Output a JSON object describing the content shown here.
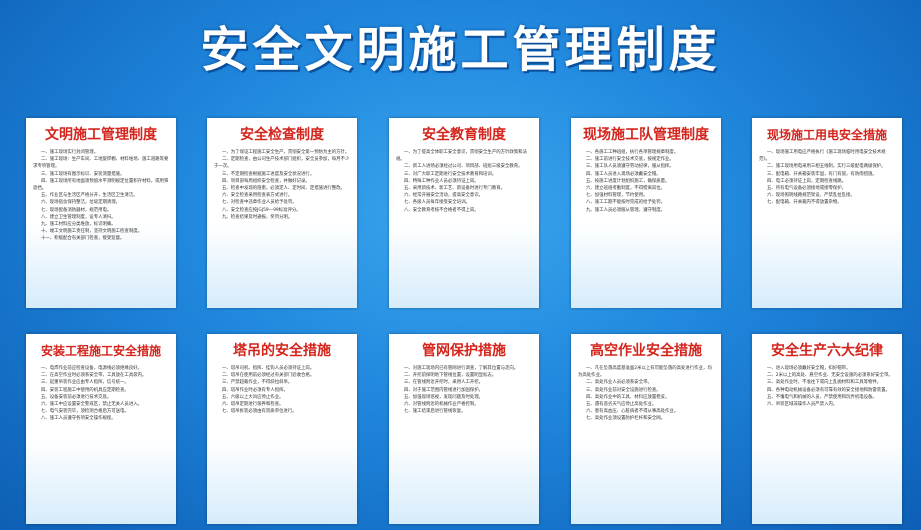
{
  "title": "安全文明施工管理制度",
  "panels": [
    {
      "title": "文明施工管理制度",
      "lines": [
        "一、施工现场实行封闭管理。",
        "二、施工现场：生产车间、工地旋焊棚、材料堆场、施工道路等要求专项管理。",
        "三、施工现场有图示标识、安装测量措施。",
        "四、施工现场所有地面须预留水平测明规定位置积存材料，或用筛遮挡。",
        "五、作业区与生活区严格分开，生活区卫生清洁。",
        "六、现场宿舍保持整洁，垃圾定期清理。",
        "七、现场配备消防器材，规范用电。",
        "八、建立卫生管理制度，设专人清扫。",
        "九、施工材料应分类堆放，标识明确。",
        "十、竣工文明施工责任制，坚持文明施工检查制度。",
        "十一、积极配合有关部门检查，接受监督。"
      ]
    },
    {
      "title": "安全检查制度",
      "lines": [
        "一、为了保证工程施工安全生产，贯彻安全第一预防为主的方针。",
        "二、定期检查，由公司生产技术部门组织，安全员参加，每月不少于一次。",
        "三、不定期检查根据施工进度及安全状况进行。",
        "四、项目部每周组织安全检查，并做好记录。",
        "五、检查中发现的隐患，必须定人、定时间、定措施进行整改。",
        "六、安全检查采用检查表方式进行。",
        "七、对检查中违章作业人员给予处罚。",
        "八、安全检查应按JGJ59—99标准评分。",
        "九、检查结果及时通报，奖罚分明。"
      ]
    },
    {
      "title": "安全教育制度",
      "lines": [
        "一、为了提高全体职工安全意识，贯彻安全生产的方针政策和法规。",
        "二、新工人进场必须经过公司、项目部、班组三级安全教育。",
        "三、对广大职工定期进行安全技术教育和培训。",
        "四、特殊工种作业人员必须持证上岗。",
        "五、采用新技术、新工艺、新设备时进行专门教育。",
        "六、经常开展安全活动，提高安全意识。",
        "七、各级人员每年接受安全培训。",
        "八、安全教育考核不合格者不得上岗。"
      ]
    },
    {
      "title": "现场施工队管理制度",
      "lines": [
        "一、各施工工种班组，执行各项管理规章制度。",
        "二、施工前进行安全技术交底，按规定作业。",
        "三、施工队人员须遵守劳动纪律，服从指挥。",
        "四、施工人员进入现场必须戴安全帽。",
        "五、按施工进度计划组织施工，确保质量。",
        "六、建立班组考勤制度，不得擅离岗位。",
        "七、加强材料管理，节约使用。",
        "八、施工工期不能按时完成的给予处罚。",
        "九、施工人员必须服从管理，遵守制度。"
      ]
    },
    {
      "title": "现场施工用电安全措施",
      "small": true,
      "lines": [
        "一、现场施工用电应严格执行《施工现场临时用电安全技术规范》。",
        "二、施工现场用电采用三相五线制，实行三级配电两级保护。",
        "三、配电箱、开关箱安装牢固，有门有锁，有防雨措施。",
        "四、电工必须持证上岗，定期检查线路。",
        "五、所有电气设备必须接地或接零保护。",
        "六、现场照明线路规范架设，严禁乱拉乱接。",
        "七、配电箱、开关箱内不得放置杂物。"
      ]
    },
    {
      "title": "安装工程施工安全措施",
      "small": true,
      "lines": [
        "一、电焊作业前应检查设备，电源线必须绝缘良好。",
        "二、在高空作业时必须系安全带，工具放在工具袋内。",
        "三、起重吊装作业应由专人指挥，信号统一。",
        "四、安装工程施工中使用的机具应定期检查。",
        "五、设备安装前必须进行技术交底。",
        "六、施工中应设置安全警戒区，禁止无关人员进入。",
        "七、电气安装完毕，须检测合格后方可送电。",
        "八、施工人员遵守各项安全操作规程。"
      ]
    },
    {
      "title": "塔吊的安全措施",
      "lines": [
        "一、塔吊司机、指挥、挂钩人员必须持证上岗。",
        "二、塔吊在使用前必须经过有关部门验收合格。",
        "三、严禁超载作业，不得斜拉斜吊。",
        "四、塔吊作业时必须有专人指挥。",
        "五、六级以上大风应停止作业。",
        "六、塔吊定期进行保养和检查。",
        "七、塔吊拆装必须由有资质单位进行。"
      ]
    },
    {
      "title": "管网保护措施",
      "lines": [
        "一、对施工现场内已有管网进行调查，了解其位置与走向。",
        "二、开挖前探明地下管线位置，设置明显标志。",
        "三、在管线附近开挖时，采用人工开挖。",
        "四、对于施工范围内管线进行加固保护。",
        "五、加强现场巡视，发现问题及时处理。",
        "六、对管线附近的机械作业严格控制。",
        "七、施工结束后进行管线恢复。"
      ]
    },
    {
      "title": "高空作业安全措施",
      "lines": [
        "一、凡在坠落高度基准面2米以上有可能坠落的高处进行作业，均为高处作业。",
        "二、高处作业人员必须系安全带。",
        "三、高处作业前对安全设施进行检查。",
        "四、高处作业中的工具、材料应放置稳妥。",
        "五、遇有恶劣天气应停止高处作业。",
        "六、患有高血压、心脏病者不得从事高处作业。",
        "七、高处作业须设置防护栏杆和安全网。"
      ]
    },
    {
      "title": "安全生产六大纪律",
      "lines": [
        "一、进入现场必须戴好安全帽，扣好帽带。",
        "二、2米以上的高处、悬空作业、无安全设施的必须系好安全带。",
        "三、高处作业时，不准往下或向上乱抛材料和工具等物件。",
        "四、各种电动机械设备必须有可靠有效的安全接地和防雷装置。",
        "五、不懂电气和机械的人员，严禁使用和玩弄机电设备。",
        "六、吊装区域非操作人员严禁入内。"
      ]
    }
  ]
}
